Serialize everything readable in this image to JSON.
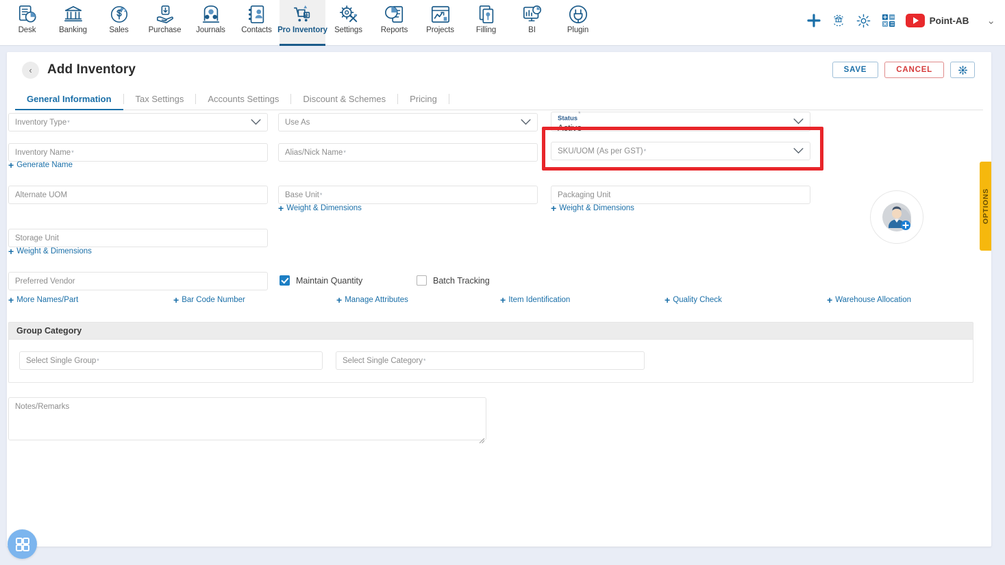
{
  "topnav": {
    "items": [
      {
        "label": "Desk",
        "icon": "desk-icon",
        "active": false
      },
      {
        "label": "Banking",
        "icon": "bank-icon",
        "active": false
      },
      {
        "label": "Sales",
        "icon": "sales-icon",
        "active": false
      },
      {
        "label": "Purchase",
        "icon": "purchase-icon",
        "active": false
      },
      {
        "label": "Journals",
        "icon": "journals-icon",
        "active": false
      },
      {
        "label": "Contacts",
        "icon": "contacts-icon",
        "active": false
      },
      {
        "label": "Pro Inventory",
        "icon": "inventory-icon",
        "active": true
      },
      {
        "label": "Settings",
        "icon": "tools-icon",
        "active": false
      },
      {
        "label": "Reports",
        "icon": "reports-icon",
        "active": false
      },
      {
        "label": "Projects",
        "icon": "projects-icon",
        "active": false
      },
      {
        "label": "Filling",
        "icon": "filling-icon",
        "active": false
      },
      {
        "label": "BI",
        "icon": "bi-icon",
        "active": false
      },
      {
        "label": "Plugin",
        "icon": "plugin-icon",
        "active": false
      }
    ],
    "right": {
      "add_icon": "plus-icon",
      "bank_sync_icon": "bank-refresh-icon",
      "settings_icon": "gear-icon",
      "calculator_icon": "calculator-icon",
      "video_icon": "youtube-icon",
      "user_name": "Point-AB",
      "dropdown_icon": "chevron-down-icon"
    }
  },
  "header": {
    "back_icon": "back-chevron-icon",
    "title": "Add Inventory",
    "save_label": "SAVE",
    "cancel_label": "CANCEL",
    "gear_icon": "gear-icon"
  },
  "tabs": [
    {
      "label": "General Information",
      "active": true
    },
    {
      "label": "Tax Settings",
      "active": false
    },
    {
      "label": "Accounts Settings",
      "active": false
    },
    {
      "label": "Discount & Schemes",
      "active": false
    },
    {
      "label": "Pricing",
      "active": false
    }
  ],
  "form": {
    "inventory_type": {
      "placeholder": "Inventory Type",
      "required": true,
      "value": ""
    },
    "use_as": {
      "placeholder": "Use As",
      "required": false,
      "value": ""
    },
    "status": {
      "label": "Status",
      "required": true,
      "value": "Active"
    },
    "inventory_name": {
      "placeholder": "Inventory Name",
      "required": true,
      "value": ""
    },
    "alias_nick_name": {
      "placeholder": "Alias/Nick Name",
      "required": true,
      "value": ""
    },
    "sku_uom": {
      "placeholder": "SKU/UOM (As per GST)",
      "required": true,
      "value": "",
      "highlighted": true
    },
    "generate_name_link": "Generate Name",
    "alternate_uom": {
      "placeholder": "Alternate UOM",
      "required": false,
      "value": ""
    },
    "base_unit": {
      "placeholder": "Base Unit",
      "required": true,
      "value": ""
    },
    "packaging_unit": {
      "placeholder": "Packaging Unit",
      "required": false,
      "value": ""
    },
    "weight_dimensions_base": "Weight & Dimensions",
    "weight_dimensions_packaging": "Weight & Dimensions",
    "storage_unit": {
      "placeholder": "Storage Unit",
      "required": false,
      "value": ""
    },
    "weight_dimensions_storage": "Weight & Dimensions",
    "preferred_vendor": {
      "placeholder": "Preferred Vendor",
      "required": false,
      "value": ""
    },
    "maintain_quantity": {
      "label": "Maintain Quantity",
      "checked": true
    },
    "batch_tracking": {
      "label": "Batch Tracking",
      "checked": false
    },
    "action_links": [
      "More Names/Part",
      "Bar Code Number",
      "Manage Attributes",
      "Item Identification",
      "Quality Check",
      "Warehouse Allocation"
    ],
    "group_category": {
      "title": "Group Category",
      "select_group": {
        "placeholder": "Select Single Group",
        "required": true,
        "value": ""
      },
      "select_category": {
        "placeholder": "Select Single Category",
        "required": true,
        "value": ""
      }
    },
    "notes": {
      "placeholder": "Notes/Remarks",
      "value": ""
    }
  },
  "avatar": {
    "icon": "add-user-avatar-icon"
  },
  "options_tab": {
    "label": "OPTIONS"
  },
  "fab": {
    "icon": "apps-grid-icon"
  },
  "colors": {
    "accent_blue": "#1a6fa8",
    "nav_active_underline": "#1b5b8a",
    "danger_red": "#d63a3a",
    "highlight_red": "#e8252a",
    "checkbox_blue": "#1d7fc4",
    "options_yellow": "#f6b80d",
    "fab_blue": "#7cb5ee",
    "page_bg": "#e9edf6"
  }
}
